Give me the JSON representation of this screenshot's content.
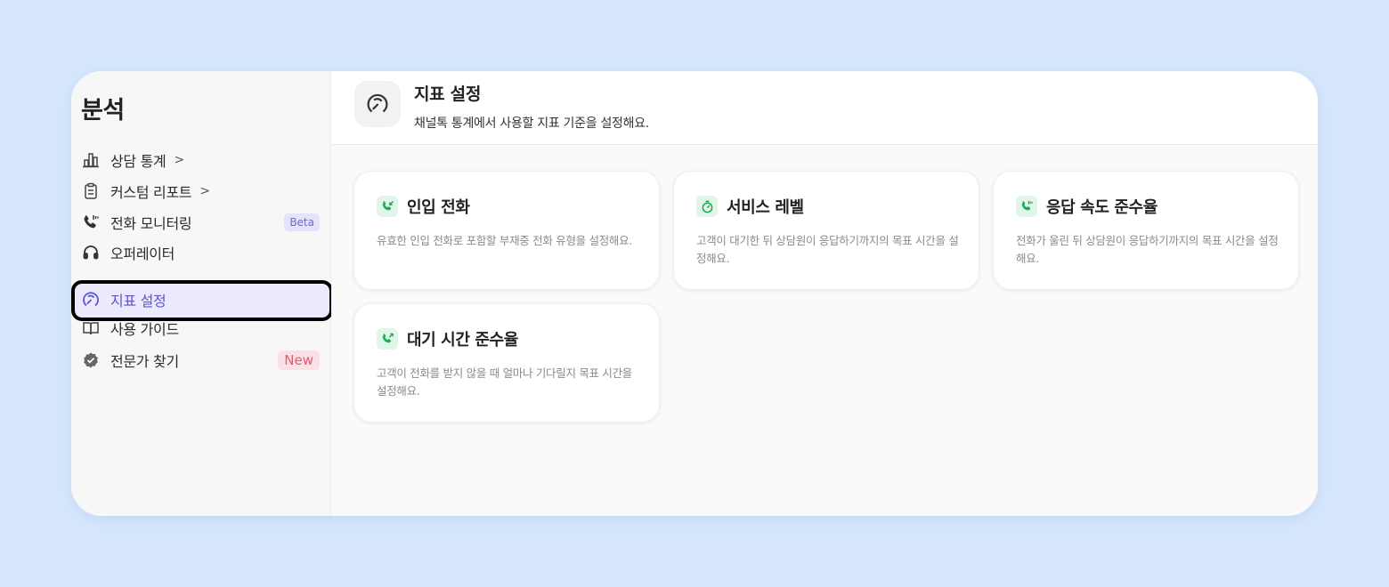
{
  "sidebar": {
    "title": "분석",
    "items": [
      {
        "label": "상담 통계",
        "chevron": ">",
        "icon": "bar-chart-icon"
      },
      {
        "label": "커스텀 리포트",
        "chevron": ">",
        "icon": "clipboard-icon"
      },
      {
        "label": "전화 모니터링",
        "badge": "Beta",
        "icon": "phone-wave-icon"
      },
      {
        "label": "오퍼레이터",
        "icon": "headset-icon"
      },
      {
        "label": "지표 설정",
        "icon": "gauge-icon",
        "active": true
      },
      {
        "label": "사용 가이드",
        "icon": "book-icon"
      },
      {
        "label": "전문가 찾기",
        "badge": "New",
        "icon": "verified-badge-icon"
      }
    ]
  },
  "header": {
    "icon": "gauge-icon",
    "title": "지표 설정",
    "subtitle": "채널톡 통계에서 사용할 지표 기준을 설정해요."
  },
  "cards": [
    {
      "title": "인입 전화",
      "icon": "incoming-call-icon",
      "description": "유효한 인입 전화로 포함할 부재중 전화 유형을 설정해요."
    },
    {
      "title": "서비스 레벨",
      "icon": "timer-icon",
      "description": "고객이 대기한 뒤 상담원이 응답하기까지의 목표 시간을 설정해요."
    },
    {
      "title": "응답 속도 준수율",
      "icon": "phone-ring-icon",
      "description": "전화가 울린 뒤 상담원이 응답하기까지의 목표 시간을 설정해요."
    },
    {
      "title": "대기 시간 준수율",
      "icon": "phone-wait-icon",
      "description": "고객이 전화를 받지 않을 때 얼마나 기다릴지 목표 시간을 설정해요."
    }
  ],
  "colors": {
    "background": "#d6e7fd",
    "accent": "#5b56d0",
    "active_bg": "#ebe9fb",
    "card_icon_green": "#1fa855",
    "beta_badge": "#6e6ad6",
    "new_badge": "#e05b73"
  }
}
